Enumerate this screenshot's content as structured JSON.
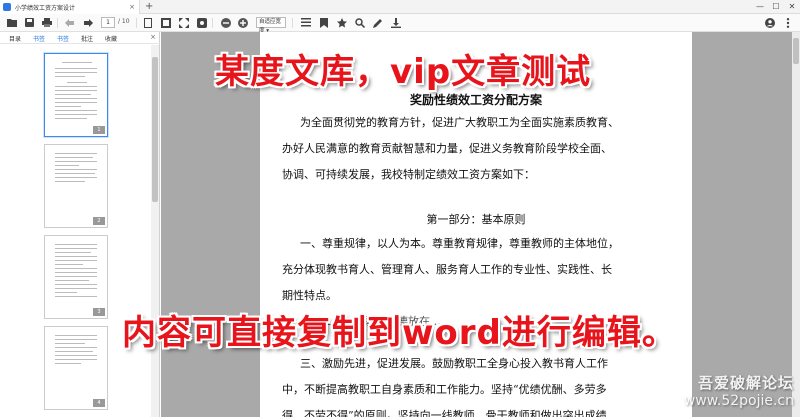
{
  "titlebar": {
    "tab_title": "小学绩效工资方案设计",
    "tab_close": "×",
    "new_tab": "+",
    "min": "—",
    "max": "☐",
    "close": "✕"
  },
  "toolbar": {
    "page_current": "1",
    "page_total": "/ 10",
    "zoom_value": "自适应宽度 ▾"
  },
  "sidebar": {
    "tabs": [
      "目录",
      "书签",
      "书签",
      "批注",
      "收藏"
    ],
    "close": "×",
    "thumbnails": [
      {
        "num": "1",
        "active": true
      },
      {
        "num": "2",
        "active": false
      },
      {
        "num": "3",
        "active": false
      },
      {
        "num": "4",
        "active": false
      }
    ]
  },
  "document": {
    "title": "奖励性绩效工资分配方案",
    "lines": [
      "为全面贯彻党的教育方针，促进广大教职工为全面实施素质教育、",
      "办好人民满意的教育贡献智慧和力量，促进义务教育阶段学校全面、",
      "协调、可持续发展，我校特制定绩效工资方案如下："
    ],
    "section1": "第一部分：基本原则",
    "principles": [
      "一、尊重规律，以人为本。尊重教育规律，尊重教师的主体地位，",
      "充分体现教书育人、管理育人、服务育人工作的专业性、实践性、长",
      "期性特点。"
    ],
    "partial_line": "二、…把职业道德放在…",
    "principle3": [
      "三、激励先进，促进发展。鼓励教职工全身心投入教书育人工作",
      "中，不断提高教职工自身素质和工作能力。坚持“优绩优酬、多劳多",
      "得、不劳不得”的原则。坚持向一线教师、骨干教师和做出突出成绩"
    ]
  },
  "overlay": {
    "top_caption": "某度文库，vip文章测试",
    "bottom_caption": "内容可直接复制到word进行编辑。"
  },
  "watermark": {
    "line1": "吾爱破解论坛",
    "line2": "www.52pojie.cn"
  }
}
